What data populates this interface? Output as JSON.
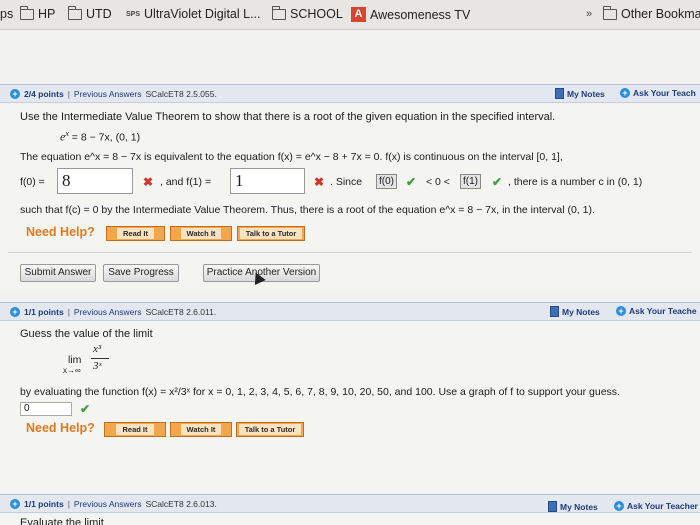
{
  "bookmarks": {
    "items": [
      "ps",
      "HP",
      "UTD",
      "UltraViolet Digital L...",
      "SCHOOL",
      "Awesomeness TV"
    ],
    "sps": "SPS",
    "aw_letter": "A",
    "overflow": "»",
    "other": "Other Bookma"
  },
  "q1": {
    "points": "2/4 points",
    "sep": "|",
    "prev": "Previous Answers",
    "code": "SCalcET8 2.5.055.",
    "my_notes": "My Notes",
    "ask": "Ask Your Teach",
    "instruction": "Use the Intermediate Value Theorem to show that there is a root of the given equation in the specified interval.",
    "equation": "e",
    "equation_sup": "x",
    "equation_rest": " = 8 − 7x,    (0, 1)",
    "line1": "The equation  e^x = 8 − 7x  is equivalent to the equation  f(x) = e^x − 8 + 7x = 0.   f(x)  is continuous on the interval  [0, 1],",
    "f0_label": "f(0) =",
    "f0_value": "8",
    "f1_label": ",  and  f(1) =",
    "f1_value": "1",
    "since": ".  Since",
    "sel1": "f(0)",
    "mid": "< 0 <",
    "sel2": "f(1)",
    "tail": ",  there is a number c in  (0, 1)",
    "line3": "such that  f(c) = 0  by the Intermediate Value Theorem. Thus, there is a root of the equation  e^x = 8 − 7x,  in the interval  (0, 1).",
    "need_help": "Need Help?",
    "read": "Read It",
    "watch": "Watch It",
    "talk": "Talk to a Tutor",
    "submit": "Submit Answer",
    "save": "Save Progress",
    "practice": "Practice Another Version"
  },
  "q2": {
    "points": "1/1 points",
    "sep": "|",
    "prev": "Previous Answers",
    "code": "SCalcET8 2.6.011.",
    "my_notes": "My Notes",
    "ask": "Ask Your Teache",
    "prompt": "Guess the value of the limit",
    "lim": "lim",
    "lim_sub": "x→∞",
    "frac_num": "x³",
    "frac_den": "3ˣ",
    "line": "by evaluating the function  f(x) = x²/3ˣ  for x = 0, 1, 2, 3, 4, 5, 6, 7, 8, 9, 10, 20, 50, and 100. Use a graph of f to support your guess.",
    "answer": "0",
    "need_help": "Need Help?",
    "read": "Read It",
    "watch": "Watch It",
    "talk": "Talk to a Tutor"
  },
  "q3": {
    "points": "1/1 points",
    "sep": "|",
    "prev": "Previous Answers",
    "code": "SCalcET8 2.6.013.",
    "my_notes": "My Notes",
    "ask": "Ask Your Teacher",
    "prompt": "Evaluate the limit"
  },
  "colors": {
    "accent_blue": "#1d3b7a",
    "help_orange": "#e07a20",
    "error_red": "#d0342c",
    "ok_green": "#3f9e3f"
  }
}
